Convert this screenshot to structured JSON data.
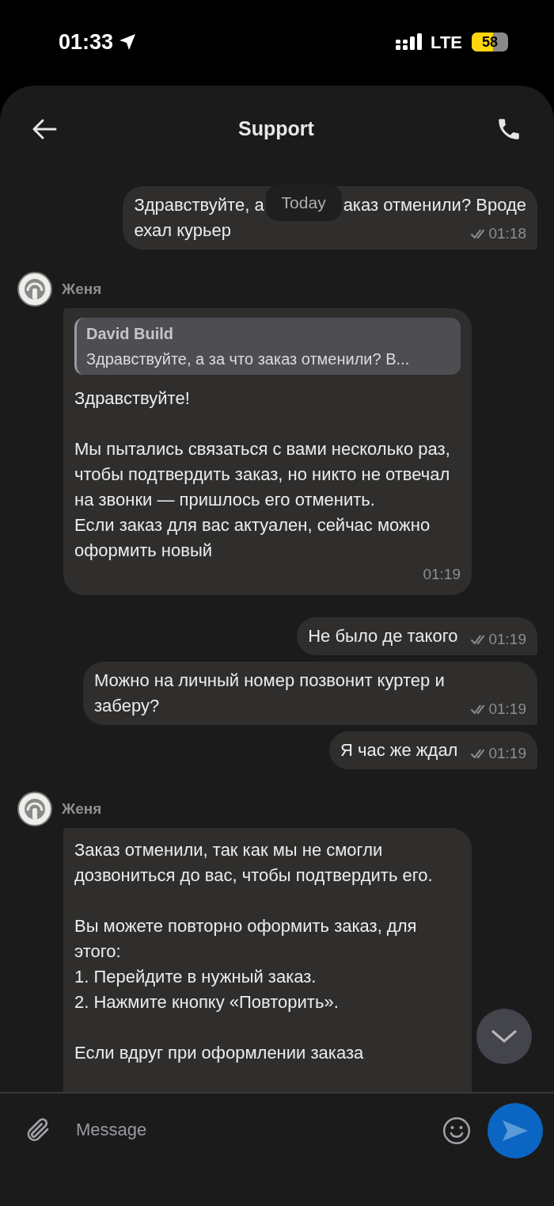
{
  "status_bar": {
    "time": "01:33",
    "network": "LTE",
    "battery": "58"
  },
  "header": {
    "title": "Support"
  },
  "date_pill": "Today",
  "messages": [
    {
      "kind": "outgoing",
      "text_before_pill": "Здравствуйте, а",
      "text_after_pill": "аказ отменили? Вроде",
      "text_next_line": "ехал курьер",
      "time": "01:18",
      "read": true
    },
    {
      "kind": "incoming",
      "sender": "Женя",
      "reply": {
        "author": "David Build",
        "text": "Здравствуйте, а за что заказ отменили? В..."
      },
      "text": "Здравствуйте!\n\nМы пытались связаться с вами несколько раз, чтобы подтвердить заказ, но никто не отвечал на звонки — пришлось его отменить.\nЕсли заказ для вас актуален, сейчас можно оформить новый",
      "time": "01:19"
    },
    {
      "kind": "outgoing",
      "text": "Не было де такого",
      "time": "01:19",
      "read": true
    },
    {
      "kind": "outgoing",
      "text": "Можно на личный номер позвонит куртер и заберу?",
      "time": "01:19",
      "read": true
    },
    {
      "kind": "outgoing",
      "text": "Я час же ждал",
      "time": "01:19",
      "read": true
    },
    {
      "kind": "incoming",
      "sender": "Женя",
      "text": "Заказ отменили, так как мы не смогли дозвониться до вас, чтобы подтвердить его.\n\nВы можете повторно оформить заказ, для этого:\n1. Перейдите в нужный заказ.\n2. Нажмите кнопку «Повторить».\n\nЕсли вдруг при оформлении заказа"
    }
  ],
  "composer": {
    "placeholder": "Message"
  }
}
